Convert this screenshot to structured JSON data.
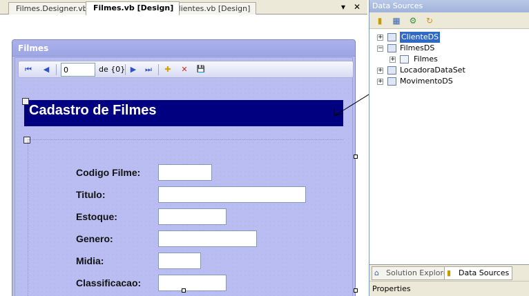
{
  "doc_tabs": {
    "items": [
      {
        "label": "Filmes.Designer.vb",
        "active": false
      },
      {
        "label": "Filmes.vb [Design]",
        "active": true
      },
      {
        "label": "Clientes.vb [Design]",
        "active": false
      }
    ],
    "menu_glyph": "▾",
    "close_glyph": "✕"
  },
  "form": {
    "title": "Filmes",
    "navigator": {
      "position_value": "0",
      "count_label": "de {0}",
      "first_glyph": "⏮",
      "prev_glyph": "◀",
      "next_glyph": "▶",
      "last_glyph": "⏭",
      "add_glyph": "✚",
      "delete_glyph": "✕",
      "save_glyph": "💾"
    },
    "header_title": "Cadastro de Filmes",
    "fields": [
      {
        "label": "Codigo Filme:"
      },
      {
        "label": "Titulo:"
      },
      {
        "label": "Estoque:"
      },
      {
        "label": "Genero:"
      },
      {
        "label": "Midia:"
      },
      {
        "label": "Classificacao:"
      }
    ]
  },
  "data_sources": {
    "title": "Data Sources",
    "toolbar_icons": [
      "add-datasource-icon",
      "edit-dataset-icon",
      "configure-icon",
      "refresh-icon"
    ],
    "tree": [
      {
        "label": "ClienteDS",
        "selected": true,
        "expander": "+"
      },
      {
        "label": "FilmesDS",
        "selected": false,
        "expander": "−"
      },
      {
        "label": "Filmes",
        "selected": false,
        "expander": "+"
      },
      {
        "label": "LocadoraDataSet",
        "selected": false,
        "expander": "+"
      },
      {
        "label": "MovimentoDS",
        "selected": false,
        "expander": "+"
      }
    ],
    "bottom_tabs": [
      {
        "label": "Solution Explorer",
        "active": false
      },
      {
        "label": "Data Sources",
        "active": true
      }
    ],
    "properties_title": "Properties"
  },
  "colors": {
    "form_body": "#b9bdf2",
    "header_panel": "#000080",
    "selection": "#316ac5",
    "annotation": "#000000"
  }
}
